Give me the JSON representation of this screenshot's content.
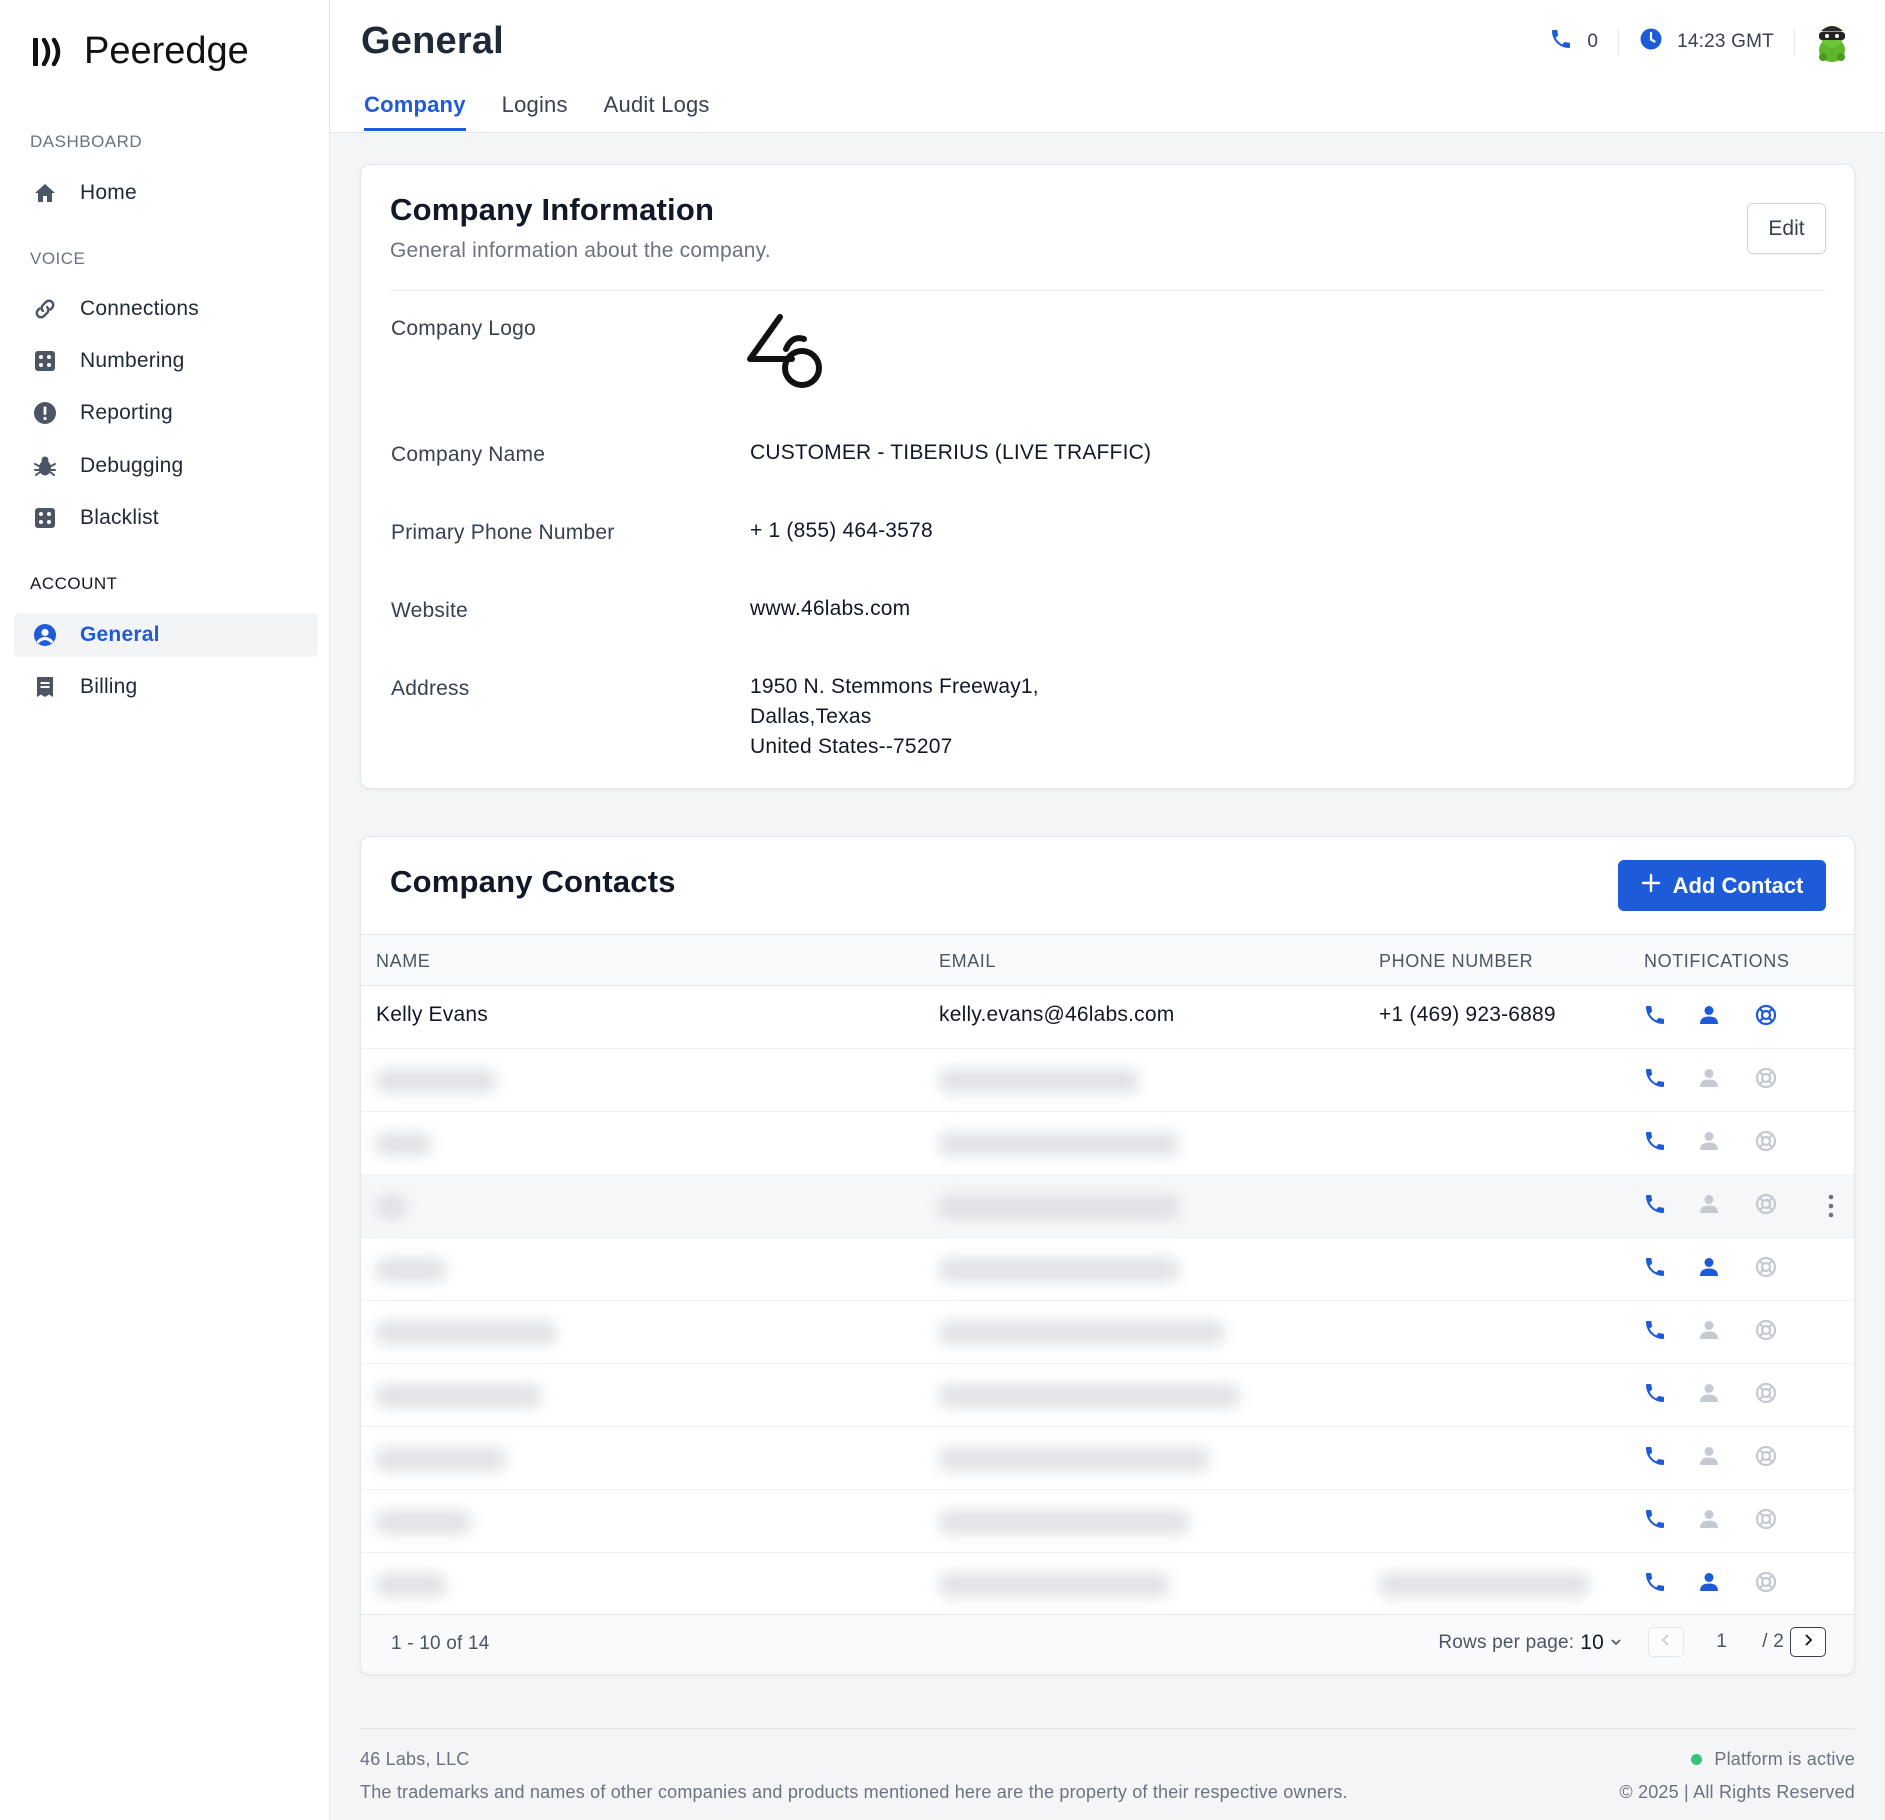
{
  "app": {
    "brand": "Peeredge",
    "brand_icon": "peeredge-logo-icon"
  },
  "sidebar": {
    "sections": [
      {
        "label": "DASHBOARD",
        "items": [
          {
            "label": "Home",
            "icon": "home-icon"
          }
        ]
      },
      {
        "label": "VOICE",
        "items": [
          {
            "label": "Connections",
            "icon": "link-icon"
          },
          {
            "label": "Numbering",
            "icon": "dice-grid-icon"
          },
          {
            "label": "Reporting",
            "icon": "alert-circle-icon"
          },
          {
            "label": "Debugging",
            "icon": "bug-icon"
          },
          {
            "label": "Blacklist",
            "icon": "dice-grid-icon"
          }
        ]
      },
      {
        "label": "ACCOUNT",
        "items": [
          {
            "label": "General",
            "icon": "user-circle-icon",
            "active": true
          },
          {
            "label": "Billing",
            "icon": "receipt-icon"
          }
        ]
      }
    ]
  },
  "header": {
    "title": "General",
    "tabs": [
      {
        "label": "Company",
        "active": true
      },
      {
        "label": "Logins"
      },
      {
        "label": "Audit Logs"
      }
    ],
    "active_calls": "0",
    "time": "14:23 GMT"
  },
  "company_info": {
    "title": "Company Information",
    "subtitle": "General information about the company.",
    "edit_label": "Edit",
    "fields": {
      "logo_label": "Company Logo",
      "logo_text": "46",
      "name_label": "Company Name",
      "name_value": "CUSTOMER - TIBERIUS (LIVE TRAFFIC)",
      "phone_label": "Primary Phone Number",
      "phone_value": "+ 1 (855) 464-3578",
      "website_label": "Website",
      "website_value": "www.46labs.com",
      "address_label": "Address",
      "address_line1": "1950 N. Stemmons Freeway1,",
      "address_line2": "Dallas,Texas",
      "address_line3": "United States--75207"
    }
  },
  "contacts": {
    "title": "Company Contacts",
    "add_label": "Add Contact",
    "columns": {
      "name": "NAME",
      "email": "EMAIL",
      "phone": "PHONE NUMBER",
      "notifications": "NOTIFICATIONS"
    },
    "rows": [
      {
        "name": "Kelly Evans",
        "email": "kelly.evans@46labs.com",
        "phone": "+1 (469) 923-6889",
        "notify_call": true,
        "notify_user": true,
        "notify_support": true
      }
    ],
    "redacted_rows": [
      {
        "notify_call": true,
        "notify_user": false,
        "notify_support": false
      },
      {
        "notify_call": true,
        "notify_user": false,
        "notify_support": false
      },
      {
        "notify_call": true,
        "notify_user": false,
        "notify_support": false
      },
      {
        "notify_call": true,
        "notify_user": true,
        "notify_support": false
      },
      {
        "notify_call": true,
        "notify_user": false,
        "notify_support": false
      },
      {
        "notify_call": true,
        "notify_user": false,
        "notify_support": false
      },
      {
        "notify_call": true,
        "notify_user": false,
        "notify_support": false
      },
      {
        "notify_call": true,
        "notify_user": false,
        "notify_support": false
      },
      {
        "notify_call": true,
        "notify_user": true,
        "notify_support": false
      }
    ],
    "pagination": {
      "range": "1 - 10 of 14",
      "rows_per_page_label": "Rows per page:",
      "rows_per_page": "10",
      "current_page": "1",
      "total_pages": "/ 2"
    }
  },
  "footer": {
    "company": "46 Labs, LLC",
    "note": "The trademarks and names of other companies and products mentioned here are the property of their respective owners.",
    "status": "Platform is active",
    "copyright": "© 2025 | All Rights Reserved"
  },
  "colors": {
    "accent": "#1d5bd8",
    "muted_icon": "#c4c9d2",
    "status_green": "#34c37b"
  }
}
